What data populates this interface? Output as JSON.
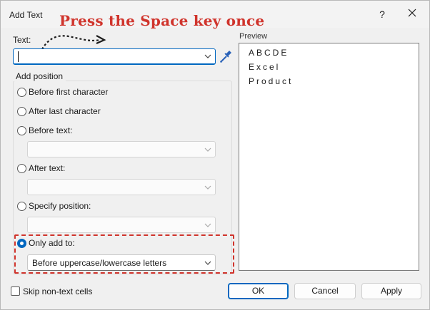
{
  "window": {
    "title": "Add Text",
    "help_glyph": "?",
    "annotation": "Press the Space key once"
  },
  "text_field": {
    "label": "Text:",
    "value": ""
  },
  "add_position": {
    "title": "Add position",
    "options": [
      {
        "label": "Before first character",
        "checked": false
      },
      {
        "label": "After last character",
        "checked": false
      },
      {
        "label": "Before text:",
        "checked": false,
        "dropdown_value": ""
      },
      {
        "label": "After text:",
        "checked": false,
        "dropdown_value": ""
      },
      {
        "label": "Specify position:",
        "checked": false,
        "dropdown_value": ""
      },
      {
        "label": "Only add to:",
        "checked": true,
        "dropdown_value": "Before uppercase/lowercase letters"
      }
    ]
  },
  "preview": {
    "title": "Preview",
    "lines": [
      "ABCDE",
      "Excel",
      "Product"
    ]
  },
  "footer": {
    "skip_label": "Skip non-text cells",
    "skip_checked": false,
    "ok_label": "OK",
    "cancel_label": "Cancel",
    "apply_label": "Apply"
  },
  "colors": {
    "accent": "#0067c0",
    "annotation": "#d0342c"
  }
}
